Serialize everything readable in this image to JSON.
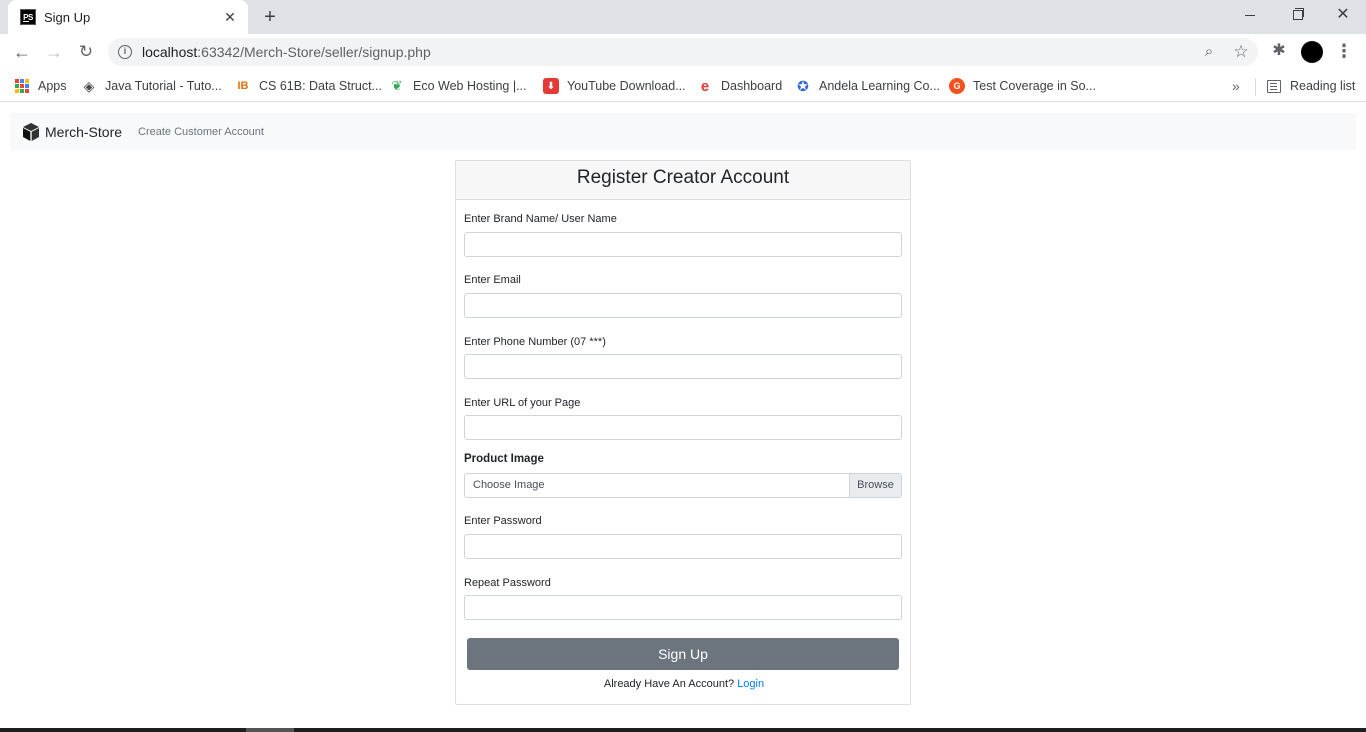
{
  "browser": {
    "tab_title": "Sign Up",
    "tab_favicon_text": "PS",
    "url_host": "localhost",
    "url_path": ":63342/Merch-Store/seller/signup.php",
    "bookmarks": [
      {
        "label": "Apps",
        "icon": "apps-grid-icon"
      },
      {
        "label": "Java Tutorial - Tuto...",
        "icon": "java-tutorial-icon"
      },
      {
        "label": "CS 61B: Data Struct...",
        "icon": "cs61b-icon"
      },
      {
        "label": "Eco Web Hosting |...",
        "icon": "eco-web-icon"
      },
      {
        "label": "YouTube Download...",
        "icon": "youtube-download-icon"
      },
      {
        "label": "Dashboard",
        "icon": "dashboard-e-icon"
      },
      {
        "label": "Andela Learning Co...",
        "icon": "andela-icon"
      },
      {
        "label": "Test Coverage in So...",
        "icon": "test-coverage-icon"
      }
    ],
    "more_bookmarks": "»",
    "reading_list": "Reading list"
  },
  "navbar": {
    "brand": "Merch-Store",
    "link": "Create Customer Account"
  },
  "form": {
    "title": "Register Creator Account",
    "brand_label": "Enter Brand Name/ User Name",
    "email_label": "Enter Email",
    "phone_label": "Enter Phone Number (07 ***)",
    "url_label": "Enter URL of your Page",
    "image_label": "Product Image",
    "image_placeholder": "Choose Image",
    "browse": "Browse",
    "password_label": "Enter Password",
    "repeat_label": "Repeat Password",
    "submit": "Sign Up",
    "login_prompt": "Already Have An Account?",
    "login_link": "Login"
  },
  "colors": {
    "submit_bg": "#6c757d",
    "link": "#007bff",
    "navbar_bg": "#f8f9fa"
  }
}
